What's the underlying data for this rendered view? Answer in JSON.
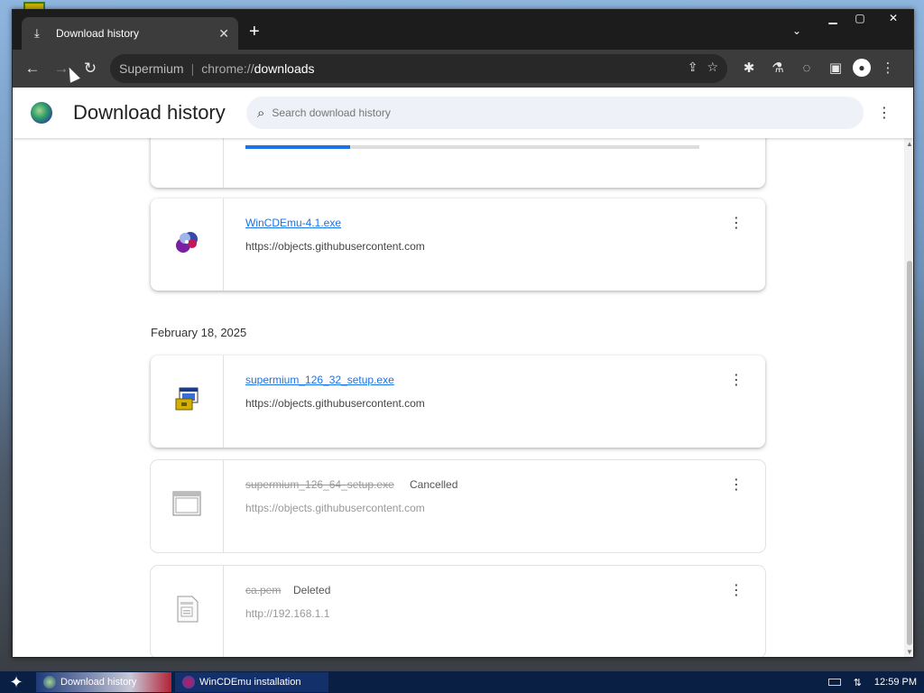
{
  "browser": {
    "tab_title": "Download history",
    "tab_icon": "download-icon",
    "omnibox": {
      "site_label": "Supermium",
      "scheme": "chrome://",
      "host": "downloads"
    }
  },
  "page": {
    "title": "Download history",
    "search_placeholder": "Search download history"
  },
  "downloads": {
    "date_header": "February 18, 2025",
    "items": [
      {
        "name": "WinCDEmu-4.1.exe",
        "url": "https://objects.githubusercontent.com",
        "status": ""
      },
      {
        "name": "supermium_126_32_setup.exe",
        "url": "https://objects.githubusercontent.com",
        "status": ""
      },
      {
        "name": "supermium_126_64_setup.exe",
        "url": "https://objects.githubusercontent.com",
        "status": "Cancelled"
      },
      {
        "name": "ca.pem",
        "url": "http://192.168.1.1",
        "status": "Deleted"
      }
    ],
    "partial_progress": 0.23
  },
  "taskbar": {
    "tasks": [
      {
        "label": "Download history",
        "icon": "browser-icon"
      },
      {
        "label": "WinCDEmu installation",
        "icon": "wincdemu-icon"
      }
    ],
    "clock": "12:59 PM"
  },
  "colors": {
    "accent": "#1a73e8",
    "tabstrip": "#1c1c1c",
    "toolbar": "#3c3c3c"
  }
}
